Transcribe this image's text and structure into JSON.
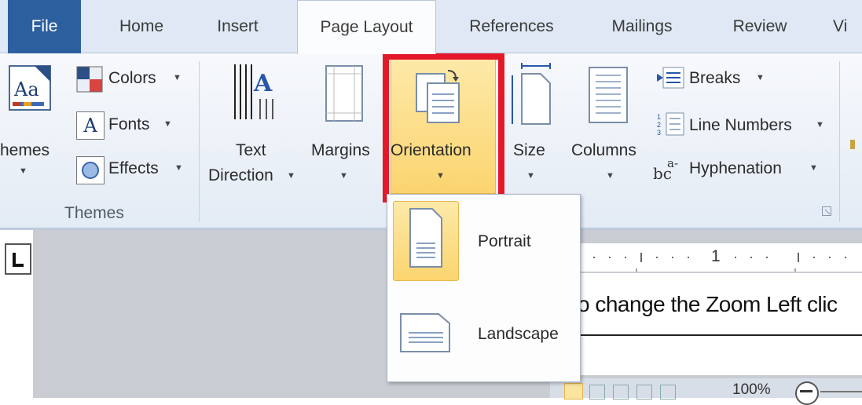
{
  "tabs": [
    {
      "label": "File"
    },
    {
      "label": "Home"
    },
    {
      "label": "Insert"
    },
    {
      "label": "Page Layout"
    },
    {
      "label": "References"
    },
    {
      "label": "Mailings"
    },
    {
      "label": "Review"
    },
    {
      "label": "Vi"
    }
  ],
  "themes_group": {
    "themes_label": "hemes",
    "colors_label": "Colors",
    "fonts_label": "Fonts",
    "effects_label": "Effects",
    "group_label": "Themes"
  },
  "page_setup": {
    "text_direction_line1": "Text",
    "text_direction_line2": "Direction",
    "margins_label": "Margins",
    "orientation_label": "Orientation",
    "size_label": "Size",
    "columns_label": "Columns",
    "breaks_label": "Breaks",
    "line_numbers_label": "Line Numbers",
    "hyphenation_label": "Hyphenation"
  },
  "orientation_menu": {
    "portrait_label": "Portrait",
    "landscape_label": "Landscape"
  },
  "document": {
    "ruler_mark": "1",
    "body_text": "o change the Zoom Left clic",
    "zoom_level": "100%"
  },
  "colors": {
    "file_tab": "#2c5f9e",
    "highlight_border": "#e3192a",
    "selected_fill": "#fbd46f"
  }
}
